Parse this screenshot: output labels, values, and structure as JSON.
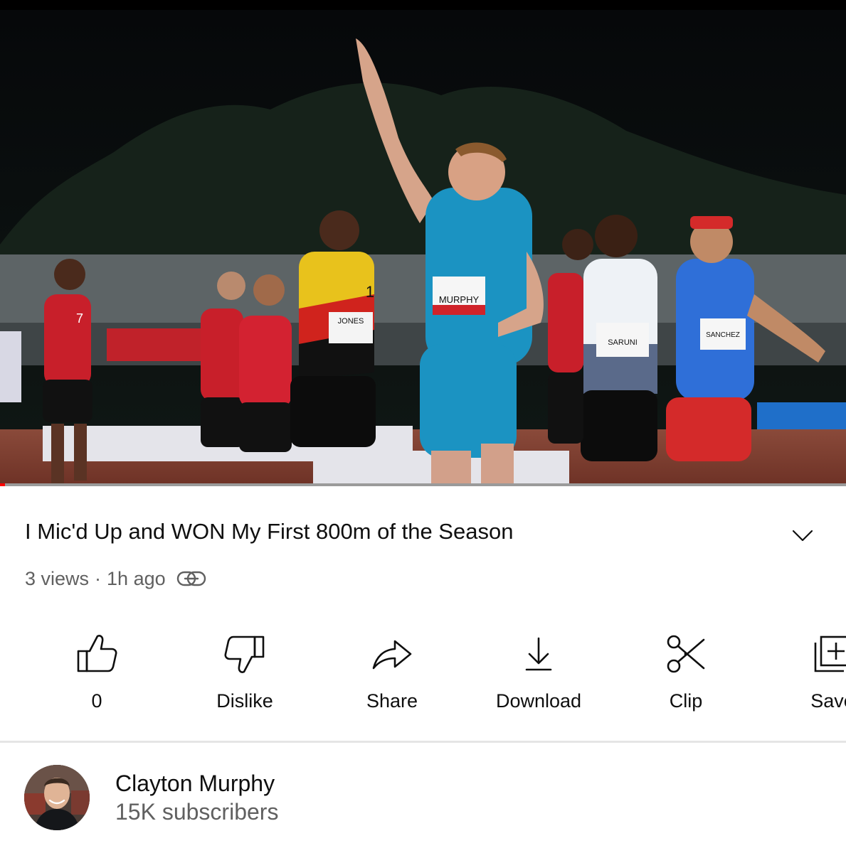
{
  "video": {
    "description": "",
    "progress_fraction": 0.006,
    "bib_labels": [
      "MURPHY",
      "JONES",
      "SARUNI",
      "SANCHEZ",
      "1",
      "7"
    ]
  },
  "video_info": {
    "title": "I Mic'd Up and WON My First 800m of the Season",
    "views": "3 views",
    "separator": "·",
    "age": "1h ago"
  },
  "actions": [
    {
      "label": "0",
      "icon": "thumbs-up-icon"
    },
    {
      "label": "Dislike",
      "icon": "thumbs-down-icon"
    },
    {
      "label": "Share",
      "icon": "share-icon"
    },
    {
      "label": "Download",
      "icon": "download-icon"
    },
    {
      "label": "Clip",
      "icon": "scissors-icon"
    },
    {
      "label": "Save",
      "icon": "save-playlist-icon"
    }
  ],
  "channel": {
    "name": "Clayton Murphy",
    "subscribers": "15K subscribers"
  },
  "colors": {
    "text_primary": "#0f0f0f",
    "text_secondary": "#606060",
    "progress": "#ff0000",
    "divider": "#e5e5e5"
  }
}
